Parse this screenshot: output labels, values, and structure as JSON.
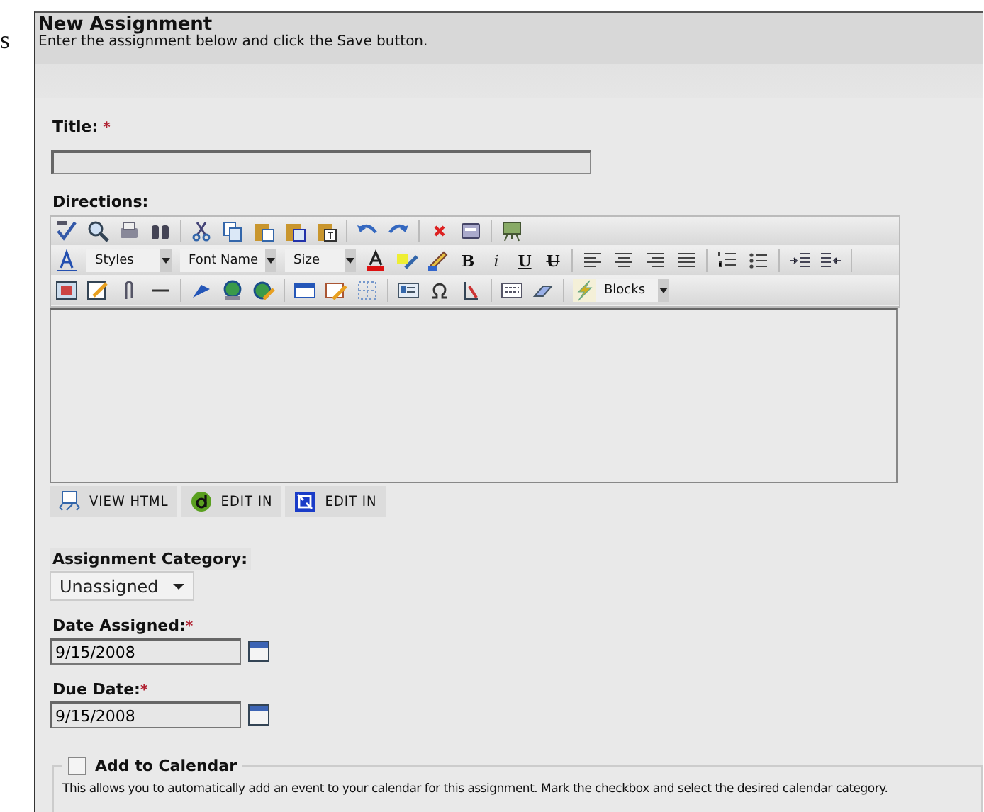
{
  "page": {
    "edge_text": "s"
  },
  "header": {
    "title": "New Assignment",
    "subtitle": "Enter the assignment below and click the Save button."
  },
  "title_field": {
    "label": "Title:",
    "required_mark": "*"
  },
  "directions": {
    "label": "Directions:",
    "dropdowns": [
      {
        "label": "Styles"
      },
      {
        "label": "Font Name"
      },
      {
        "label": "Size"
      },
      {
        "label": "Blocks"
      }
    ],
    "format_buttons": [
      "B",
      "i",
      "U",
      "U"
    ]
  },
  "editor_tabs": [
    {
      "label": "VIEW HTML",
      "kind": "view"
    },
    {
      "label": "EDIT IN",
      "kind": "green"
    },
    {
      "label": "EDIT IN",
      "kind": "blue"
    }
  ],
  "category": {
    "label": "Assignment Category:",
    "value": "Unassigned"
  },
  "date_assigned": {
    "label": "Date Assigned:",
    "required_mark": "*",
    "value": "9/15/2008"
  },
  "due_date": {
    "label": "Due Date:",
    "required_mark": "*",
    "value": "9/15/2008"
  },
  "calendar": {
    "label": "Add to Calendar",
    "checked": false,
    "description": "This allows you to automatically add an event to your calendar for this assignment. Mark the checkbox and select the desired calendar category."
  }
}
